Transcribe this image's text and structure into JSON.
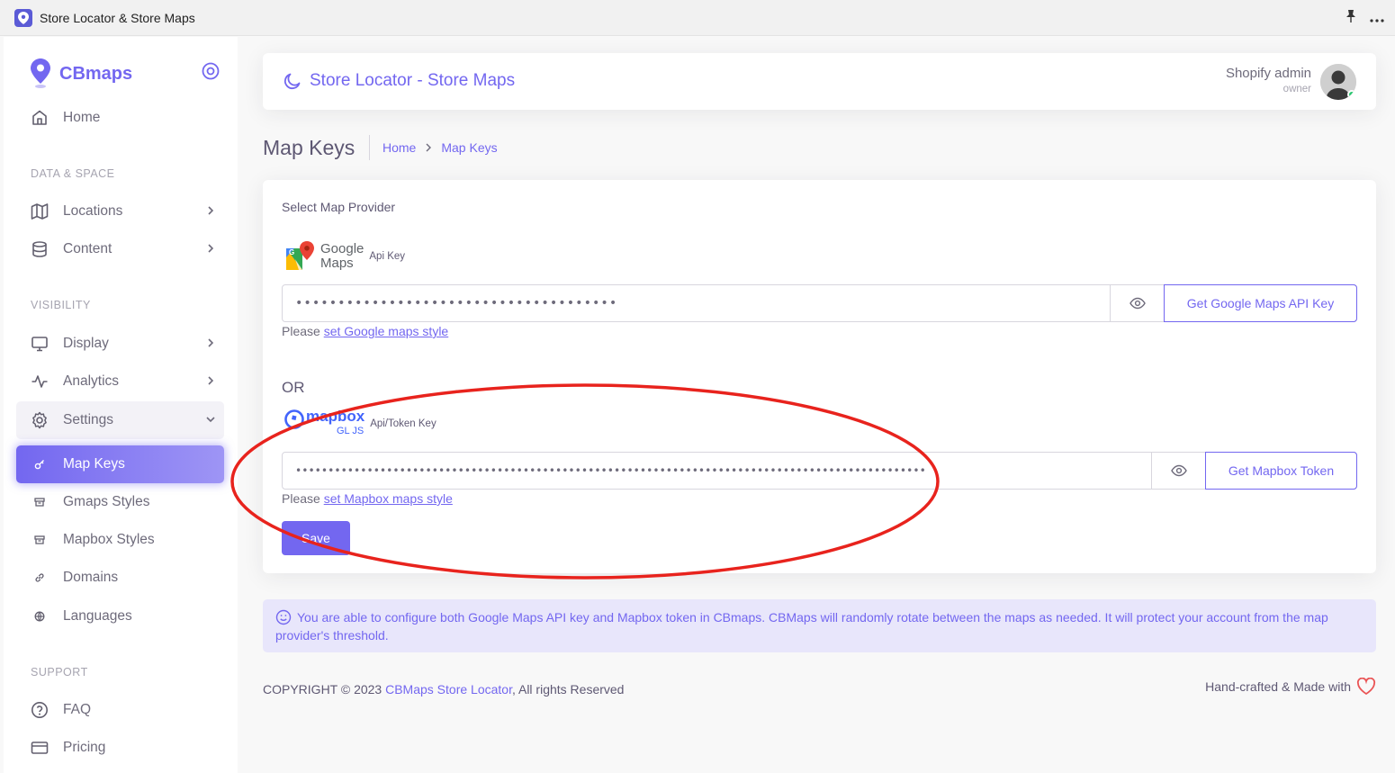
{
  "app": {
    "title": "Store Locator & Store Maps"
  },
  "sidebar": {
    "brand": "CBmaps",
    "home": "Home",
    "section_data": "DATA & SPACE",
    "locations": "Locations",
    "content": "Content",
    "section_visibility": "VISIBILITY",
    "display": "Display",
    "analytics": "Analytics",
    "settings": "Settings",
    "map_keys": "Map Keys",
    "gmaps_styles": "Gmaps Styles",
    "mapbox_styles": "Mapbox Styles",
    "domains": "Domains",
    "languages": "Languages",
    "section_support": "SUPPORT",
    "faq": "FAQ",
    "pricing": "Pricing"
  },
  "header": {
    "title": "Store Locator - Store Maps",
    "user_name": "Shopify admin",
    "user_role": "owner"
  },
  "breadcrumb": {
    "page_title": "Map Keys",
    "home": "Home",
    "current": "Map Keys"
  },
  "form": {
    "select_provider": "Select Map Provider",
    "google_word1": "Google",
    "google_word2": "Maps",
    "google_key_label": "Api Key",
    "google_value": "••••••••••••••••••••••••••••••••••••••",
    "google_get_button": "Get Google Maps API Key",
    "google_hint_prefix": "Please ",
    "google_hint_link": "set Google maps style",
    "or": "OR",
    "mapbox_word": "mapbox",
    "mapbox_sub": "GL JS",
    "mapbox_key_label": "Api/Token Key",
    "mapbox_value": "•••••••••••••••••••••••••••••••••••••••••••••••••••••••••••••••••••••••••••••••••••••••••••••••••",
    "mapbox_get_button": "Get Mapbox Token",
    "mapbox_hint_prefix": "Please ",
    "mapbox_hint_link": "set Mapbox maps style",
    "save": "Save"
  },
  "info": {
    "text": "You are able to configure both Google Maps API key and Mapbox token in CBmaps. CBMaps will randomly rotate between the maps as needed. It will protect your account from the map provider's threshold."
  },
  "footer": {
    "copyright_prefix": "COPYRIGHT © 2023 ",
    "copyright_link": "CBMaps Store Locator",
    "copyright_suffix": ", All rights Reserved",
    "right": "Hand-crafted & Made with"
  },
  "colors": {
    "accent": "#7367f0",
    "annotation": "#e8231d",
    "online": "#28c76f"
  }
}
